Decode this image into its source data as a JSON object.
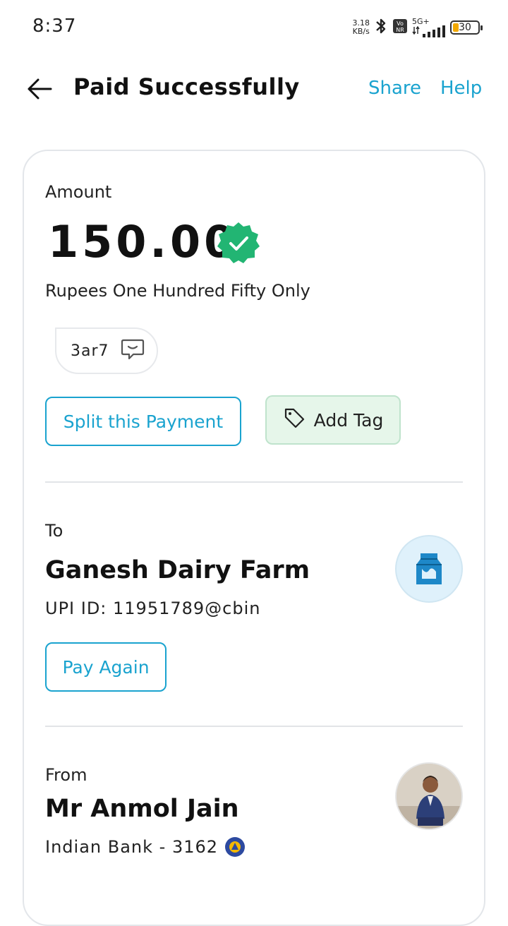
{
  "status_bar": {
    "time": "8:37",
    "net_speed_value": "3.18",
    "net_speed_unit": "KB/s",
    "network": "5G+",
    "battery": "30"
  },
  "header": {
    "title": "Paid Successfully",
    "share": "Share",
    "help": "Help"
  },
  "amount": {
    "label": "Amount",
    "value": "150.00",
    "words": "Rupees One Hundred Fifty Only"
  },
  "note": {
    "text": "3ar7"
  },
  "actions": {
    "split": "Split this Payment",
    "add_tag": "Add Tag"
  },
  "to": {
    "label": "To",
    "name": "Ganesh Dairy Farm",
    "upi": "UPI ID: 11951789@cbin",
    "pay_again": "Pay Again"
  },
  "from": {
    "label": "From",
    "name": "Mr Anmol Jain",
    "bank": "Indian Bank - 3162"
  },
  "colors": {
    "accent": "#1aa3cf",
    "success": "#22b573",
    "tag_bg": "#e6f6ea"
  }
}
